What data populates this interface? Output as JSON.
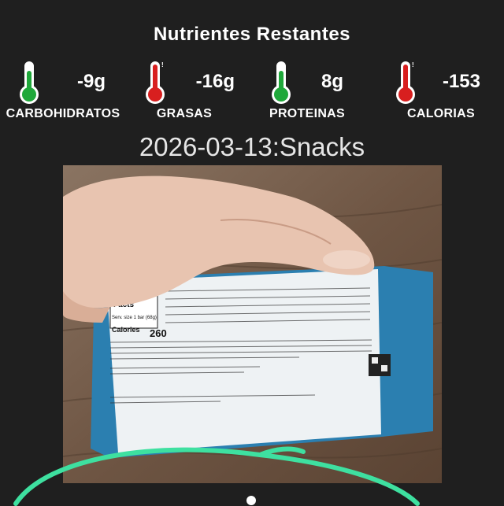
{
  "header": {
    "title": "Nutrientes Restantes"
  },
  "nutrients": [
    {
      "label": "CARBOHIDRATOS",
      "value": "-9g",
      "status_color": "#1fa83a",
      "icon": "thermometer-green-icon"
    },
    {
      "label": "GRASAS",
      "value": "-16g",
      "status_color": "#d81f1f",
      "icon": "thermometer-red-icon"
    },
    {
      "label": "PROTEINAS",
      "value": "8g",
      "status_color": "#1fa83a",
      "icon": "thermometer-green-icon"
    },
    {
      "label": "CALORIAS",
      "value": "-153",
      "status_color": "#d81f1f",
      "icon": "thermometer-red-icon"
    }
  ],
  "entry": {
    "date_meal": "2026-03-13:Snacks"
  },
  "photo": {
    "nutrition_heading": "Nutrition Facts",
    "serving": "Serv. size 1 bar (68g)",
    "calories_label": "Calories per serving",
    "calories_value": "260"
  },
  "colors": {
    "background": "#1f1f1f",
    "accent": "#3ee0a0",
    "text": "#ffffff"
  }
}
